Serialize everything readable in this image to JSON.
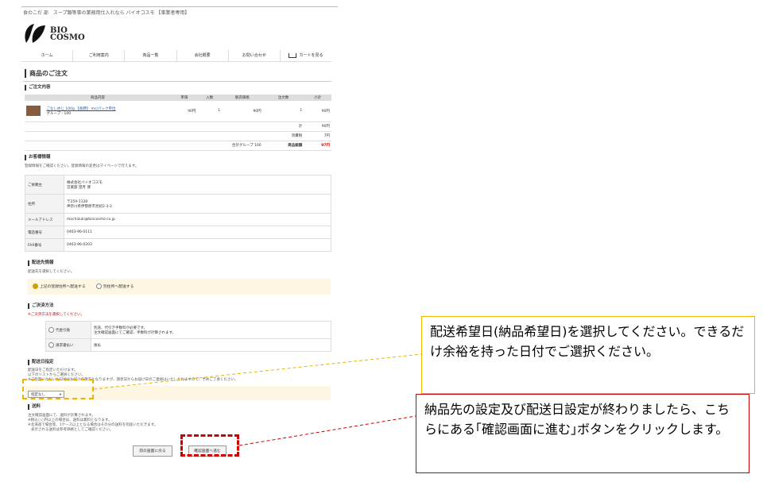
{
  "header": {
    "tagline": "食のこだ 部　スープ類等事の業務用仕入れなら バイオコスモ 【事業者専用】",
    "logo_line1": "BIO",
    "logo_line2": "COSMO"
  },
  "nav": [
    "ホーム",
    "ご利用案内",
    "商品一覧",
    "会社概要",
    "お問い合わせ",
    "カートを見る"
  ],
  "page_title": "商品のご注文",
  "order": {
    "heading": "ご注文内容",
    "columns": [
      "商品内容",
      "単価",
      "入数",
      "販売価格",
      "注文数",
      "小計"
    ],
    "item": {
      "name": "ごなしめじ 100g 【長野】 mc/パック単位",
      "group": "グループ : 100",
      "unit_price": "90円",
      "qty_per": "1",
      "price": "90円",
      "order_qty": "1",
      "subtotal": "90円"
    },
    "total_label": "計",
    "total": "90円",
    "tax_label": "消費税",
    "tax": "7円",
    "group_total_label": "合計グループ 100",
    "grand_label": "商品総額",
    "grand": "97円"
  },
  "customer": {
    "heading": "お客様情報",
    "note": "登録情報をご確認ください。登録情報の変更はマイページで行えます。",
    "rows": [
      {
        "k": "ご依頼主",
        "v1": "株式会社バイオコスモ",
        "v2": "営業部 望月 博"
      },
      {
        "k": "住所",
        "v1": "〒259-1128",
        "v2": "神奈川県伊勢原市見初2-3-2"
      },
      {
        "k": "メールアドレス",
        "v1": "mochizuki@biocosmo.co.jp",
        "v2": ""
      },
      {
        "k": "電話番号",
        "v1": "0463-96-0111",
        "v2": ""
      },
      {
        "k": "FAX番号",
        "v1": "0463-96-0203",
        "v2": ""
      }
    ]
  },
  "delivery": {
    "heading": "配送先情報",
    "note": "配送先を選択してください。",
    "opt1": "上記の登録住所へ配送する",
    "opt2": "別住所へ配送する"
  },
  "payment": {
    "heading": "ご決済方法",
    "note": "※ご決済方法を選択してください。",
    "rows": [
      {
        "k": "代金引換",
        "v1": "別途、代引き手数料が必要です。",
        "v2": "注文確認画面にてご確認、手数料が計算されます。"
      },
      {
        "k": "請求書払い",
        "v1": "後払",
        "v2": ""
      }
    ]
  },
  "date": {
    "heading": "配送日指定",
    "note1": "配送日をご指定いただけます。",
    "note2": "以下のリストからご選択ください。",
    "note3": "※ご指定いただいた日付はお届けの目安となりますが、諸状況からお届け日のご連絡はいたしかねますので、予めご了承ください。",
    "select_value": "指定なし"
  },
  "shipping": {
    "heading": "送料",
    "note1": "注文確認画面にて、送料が計算されます。",
    "note2": "※税込○○円以上の場合は、送料は無料となります。",
    "note3": "※北海道で場合等、1ケース以上となる場合はその分の送料を別途いただきます。",
    "note4": "表示される送料は参考価格としてご確認ください。"
  },
  "buttons": {
    "back": "前の画面に戻る",
    "confirm": "確認画面へ進む"
  },
  "callouts": {
    "date": "配送希望日(納品希望日)を選択してください。できるだけ余裕を持った日付でご選択ください。",
    "confirm": "納品先の設定及び配送日設定が終わりましたら、こちらにある｢確認画面に進む｣ボタンをクリックします。"
  },
  "colors": {
    "callout_date_border": "#e8b400",
    "callout_confirm_border": "#cc0000"
  }
}
